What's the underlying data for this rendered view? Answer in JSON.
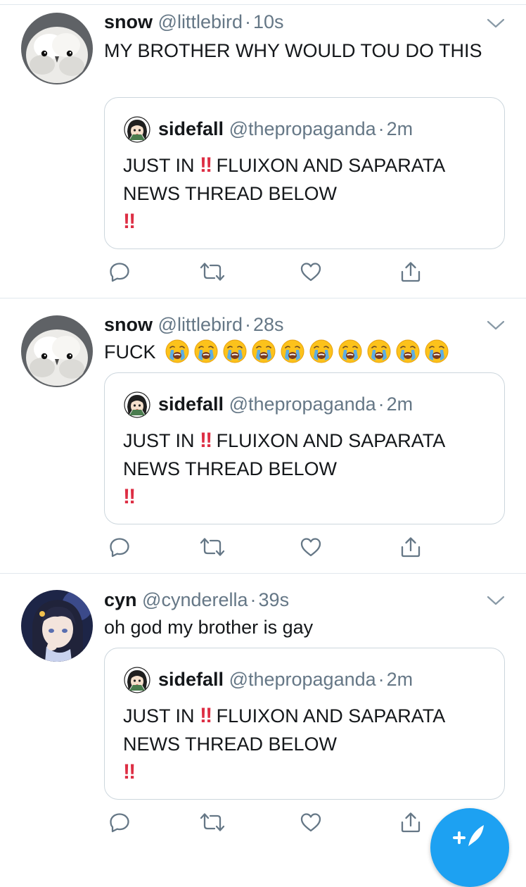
{
  "tweets": [
    {
      "name": "snow",
      "handle": "@littlebird",
      "separator": "·",
      "time": "10s",
      "text": "MY BROTHER WHY WOULD TOU DO THIS",
      "avatar_icon": "owl-chick-avatar",
      "quote": {
        "name": "sidefall",
        "handle": "@thepropaganda",
        "separator": "·",
        "time": "2m",
        "text_part1": "JUST IN",
        "bang1": "‼",
        "text_part2": "FLUIXON AND SAPARATA NEWS THREAD BELOW",
        "bang2": "‼"
      }
    },
    {
      "name": "snow",
      "handle": "@littlebird",
      "separator": "·",
      "time": "28s",
      "text": "FUCK",
      "emoji": "loudly-crying-face",
      "emoji_count": 10,
      "avatar_icon": "owl-chick-avatar",
      "quote": {
        "name": "sidefall",
        "handle": "@thepropaganda",
        "separator": "·",
        "time": "2m",
        "text_part1": "JUST IN",
        "bang1": "‼",
        "text_part2": "FLUIXON AND SAPARATA NEWS THREAD BELOW",
        "bang2": "‼"
      }
    },
    {
      "name": "cyn",
      "handle": "@cynderella",
      "separator": "·",
      "time": "39s",
      "text": "oh god my brother is gay",
      "avatar_icon": "anime-girl-avatar",
      "quote": {
        "name": "sidefall",
        "handle": "@thepropaganda",
        "separator": "·",
        "time": "2m",
        "text_part1": "JUST IN",
        "bang1": "‼",
        "text_part2": "FLUIXON AND SAPARATA NEWS THREAD BELOW",
        "bang2": "‼"
      }
    }
  ],
  "actions": [
    "reply-icon",
    "retweet-icon",
    "like-icon",
    "share-icon"
  ],
  "compose_button_icon": "compose-feather-icon",
  "colors": {
    "text": "#14171a",
    "secondary": "#657786",
    "border": "#e1e8ed",
    "quote_border": "#ccd6dd",
    "accent": "#1da1f2",
    "bang": "#dd2e44"
  }
}
